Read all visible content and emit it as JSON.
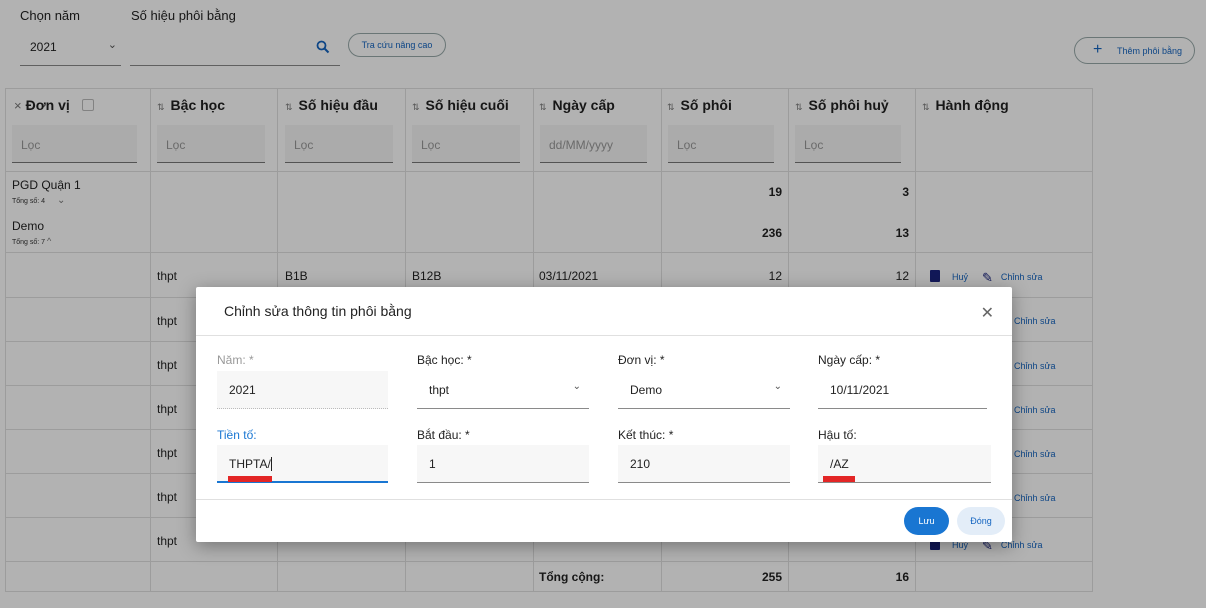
{
  "filters": {
    "year_label": "Chọn năm",
    "year_value": "2021",
    "serial_label": "Số hiệu phôi bằng",
    "serial_placeholder": "",
    "advanced_button": "Tra cứu nâng cao",
    "add_button": "Thêm phôi bằng"
  },
  "grid": {
    "headers": {
      "unit": "Đơn vị",
      "level": "Bậc học",
      "start_no": "Số hiệu đầu",
      "end_no": "Số hiệu cuối",
      "issue_date": "Ngày cấp",
      "count": "Số phôi",
      "cancelled": "Số phôi huỷ",
      "actions": "Hành động"
    },
    "filter_placeholders": {
      "generic": "Lọc",
      "date": "dd/MM/yyyy"
    },
    "groups": [
      {
        "name": "PGD Quận 1",
        "subtotal": "Tổng số: 4",
        "count": "19",
        "cancelled": "3"
      },
      {
        "name": "Demo",
        "subtotal": "Tổng số: 7",
        "count": "236",
        "cancelled": "13"
      }
    ],
    "rows": [
      {
        "level": "thpt",
        "start_no": "B1B",
        "end_no": "B12B",
        "issue_date": "03/11/2021",
        "count": "12",
        "cancelled": "12"
      },
      {
        "level": "thpt"
      },
      {
        "level": "thpt"
      },
      {
        "level": "thpt"
      },
      {
        "level": "thpt"
      },
      {
        "level": "thpt"
      },
      {
        "level": "thpt"
      }
    ],
    "actions": {
      "cancel": "Huỷ",
      "edit": "Chỉnh sửa"
    },
    "total_label": "Tổng cộng:",
    "total_count": "255",
    "total_cancelled": "16"
  },
  "dialog": {
    "title": "Chỉnh sửa thông tin phôi bằng",
    "year_label": "Năm: *",
    "year_value": "2021",
    "level_label": "Bậc học: *",
    "level_value": "thpt",
    "unit_label": "Đơn vị: *",
    "unit_value": "Demo",
    "issue_date_label": "Ngày cấp: *",
    "issue_date_value": "10/11/2021",
    "prefix_label": "Tiền tố:",
    "prefix_value": "THPTA/",
    "start_label": "Bắt đầu: *",
    "start_value": "1",
    "end_label": "Kết thúc: *",
    "end_value": "210",
    "suffix_label": "Hậu tố:",
    "suffix_value": "/AZ",
    "save_button": "Lưu",
    "close_button": "Đóng"
  },
  "colors": {
    "accent": "#1976d2",
    "highlight_mark": "#e32626",
    "overlay": "rgba(0,0,0,0.30)"
  }
}
